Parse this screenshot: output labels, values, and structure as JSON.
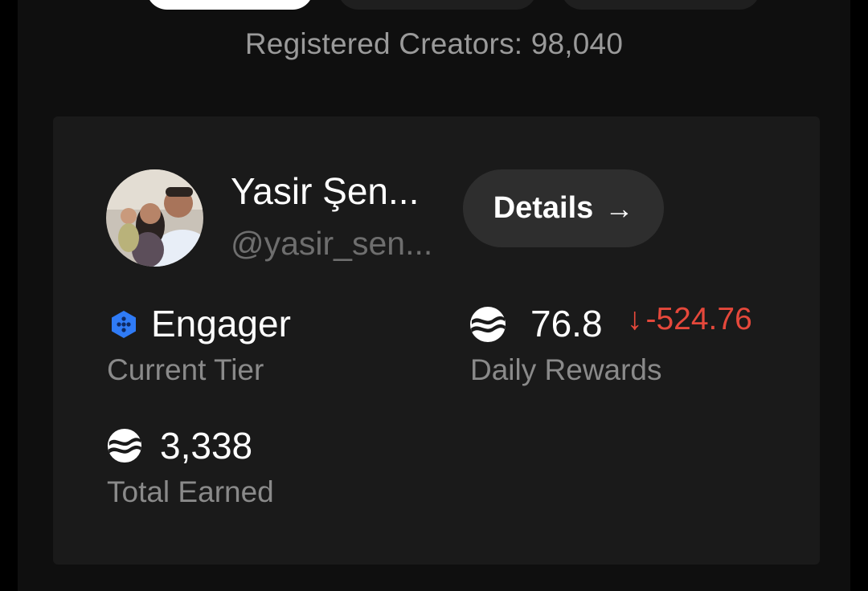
{
  "registered_text": "Registered Creators: 98,040",
  "profile": {
    "name": "Yasir Şen...",
    "handle": "@yasir_sen...",
    "details_label": "Details",
    "details_arrow": "→"
  },
  "stats": {
    "tier": {
      "value": "Engager",
      "label": "Current Tier",
      "icon": "hexagon-tier-icon"
    },
    "daily_rewards": {
      "value": "76.8",
      "change_arrow": "↓",
      "change": "-524.76",
      "label": "Daily Rewards",
      "icon": "token-icon"
    },
    "total_earned": {
      "value": "3,338",
      "label": "Total Earned",
      "icon": "token-icon"
    }
  },
  "colors": {
    "background": "#0f0f0f",
    "card": "#1a1a1a",
    "negative": "#e5483b",
    "tier_icon": "#2f7bf6"
  }
}
